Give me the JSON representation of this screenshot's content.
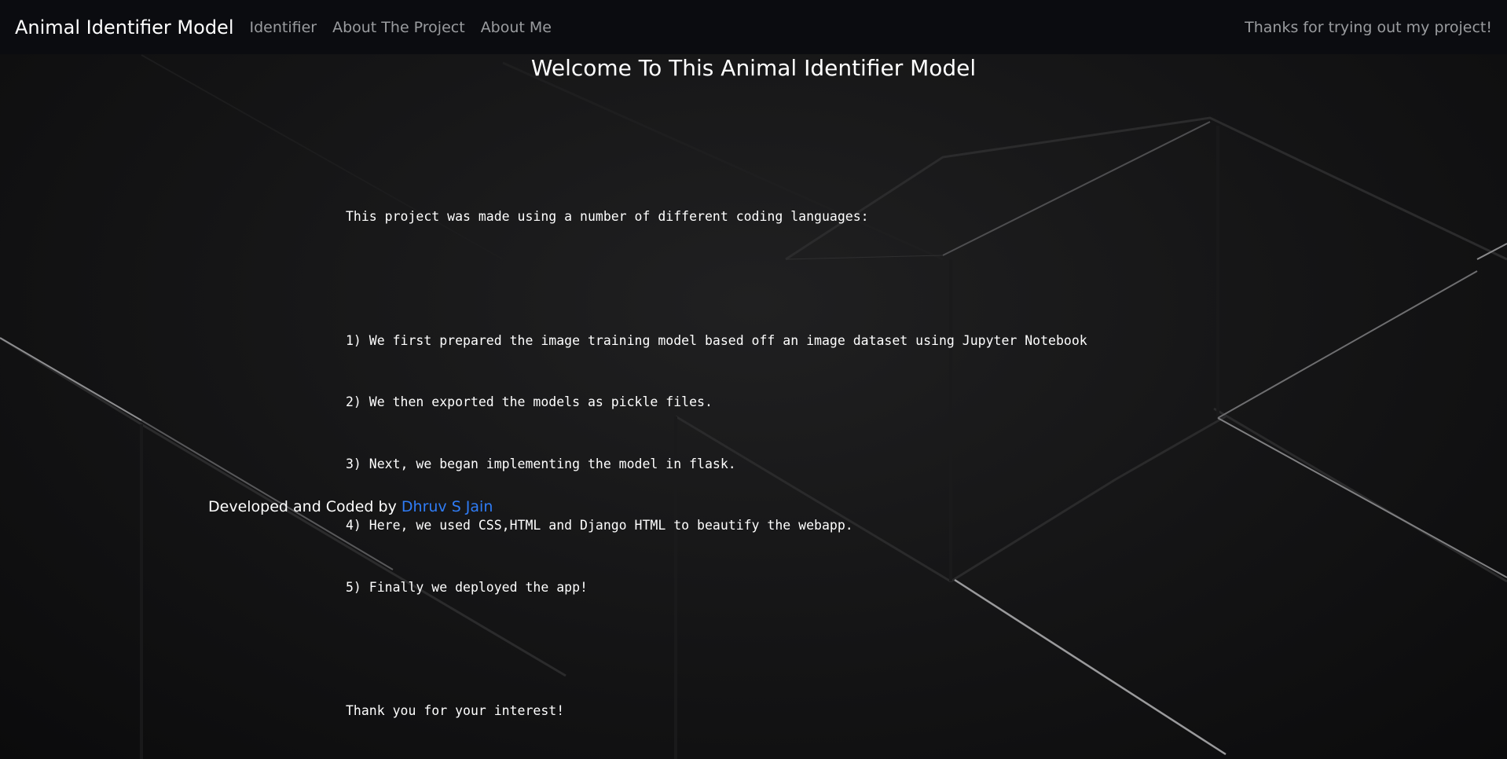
{
  "navbar": {
    "brand": "Animal Identifier Model",
    "links": [
      "Identifier",
      "About The Project",
      "About Me"
    ],
    "right_text": "Thanks for trying out my project!"
  },
  "main": {
    "title": "Welcome To This Animal Identifier Model",
    "intro": "This project was made using a number of different coding languages:",
    "steps": [
      "1) We first prepared the image training model based off an image dataset using Jupyter Notebook",
      "2) We then exported the models as pickle files.",
      "3) Next, we began implementing the model in flask.",
      "4) Here, we used CSS,HTML and Django HTML to beautify the webapp.",
      "5) Finally we deployed the app!"
    ],
    "closing": "Thank you for your interest!"
  },
  "footer": {
    "text": "Developed and Coded by ",
    "author": "Dhruv S Jain"
  },
  "colors": {
    "navbar_bg": "#0b0c10",
    "link_muted": "#9a9c9f",
    "author_link": "#2f7cf6"
  }
}
